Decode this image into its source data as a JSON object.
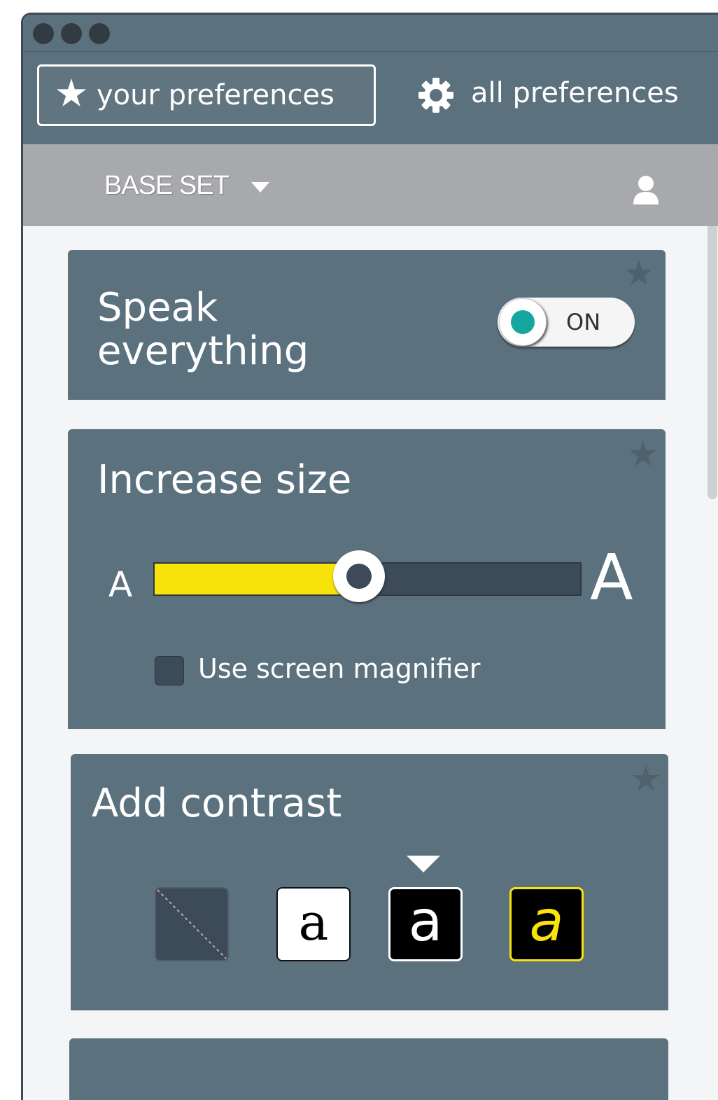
{
  "nav": {
    "your_preferences": "your preferences",
    "all_preferences": "all preferences"
  },
  "setbar": {
    "label": "BASE SET"
  },
  "panels": {
    "speak": {
      "title_line1": "Speak",
      "title_line2": "everything",
      "toggle_label": "ON",
      "toggle_state": "on"
    },
    "size": {
      "title": "Increase size",
      "small_label": "A",
      "large_label": "A",
      "slider_value": 0.4,
      "checkbox_label": "Use screen magnifier",
      "checkbox_checked": false
    },
    "contrast": {
      "title": "Add contrast",
      "options": [
        {
          "name": "none",
          "glyph": ""
        },
        {
          "name": "black-on-white",
          "glyph": "a"
        },
        {
          "name": "white-on-black",
          "glyph": "a"
        },
        {
          "name": "yellow-on-black",
          "glyph": "a"
        }
      ],
      "selected_index": 2
    }
  },
  "colors": {
    "panel": "#5b717e",
    "accent_teal": "#15a6a0",
    "accent_yellow": "#f7e20a",
    "setbar": "#a7a9ac"
  },
  "icons": [
    "star-icon",
    "gear-icon",
    "chevron-down-icon",
    "user-icon"
  ]
}
